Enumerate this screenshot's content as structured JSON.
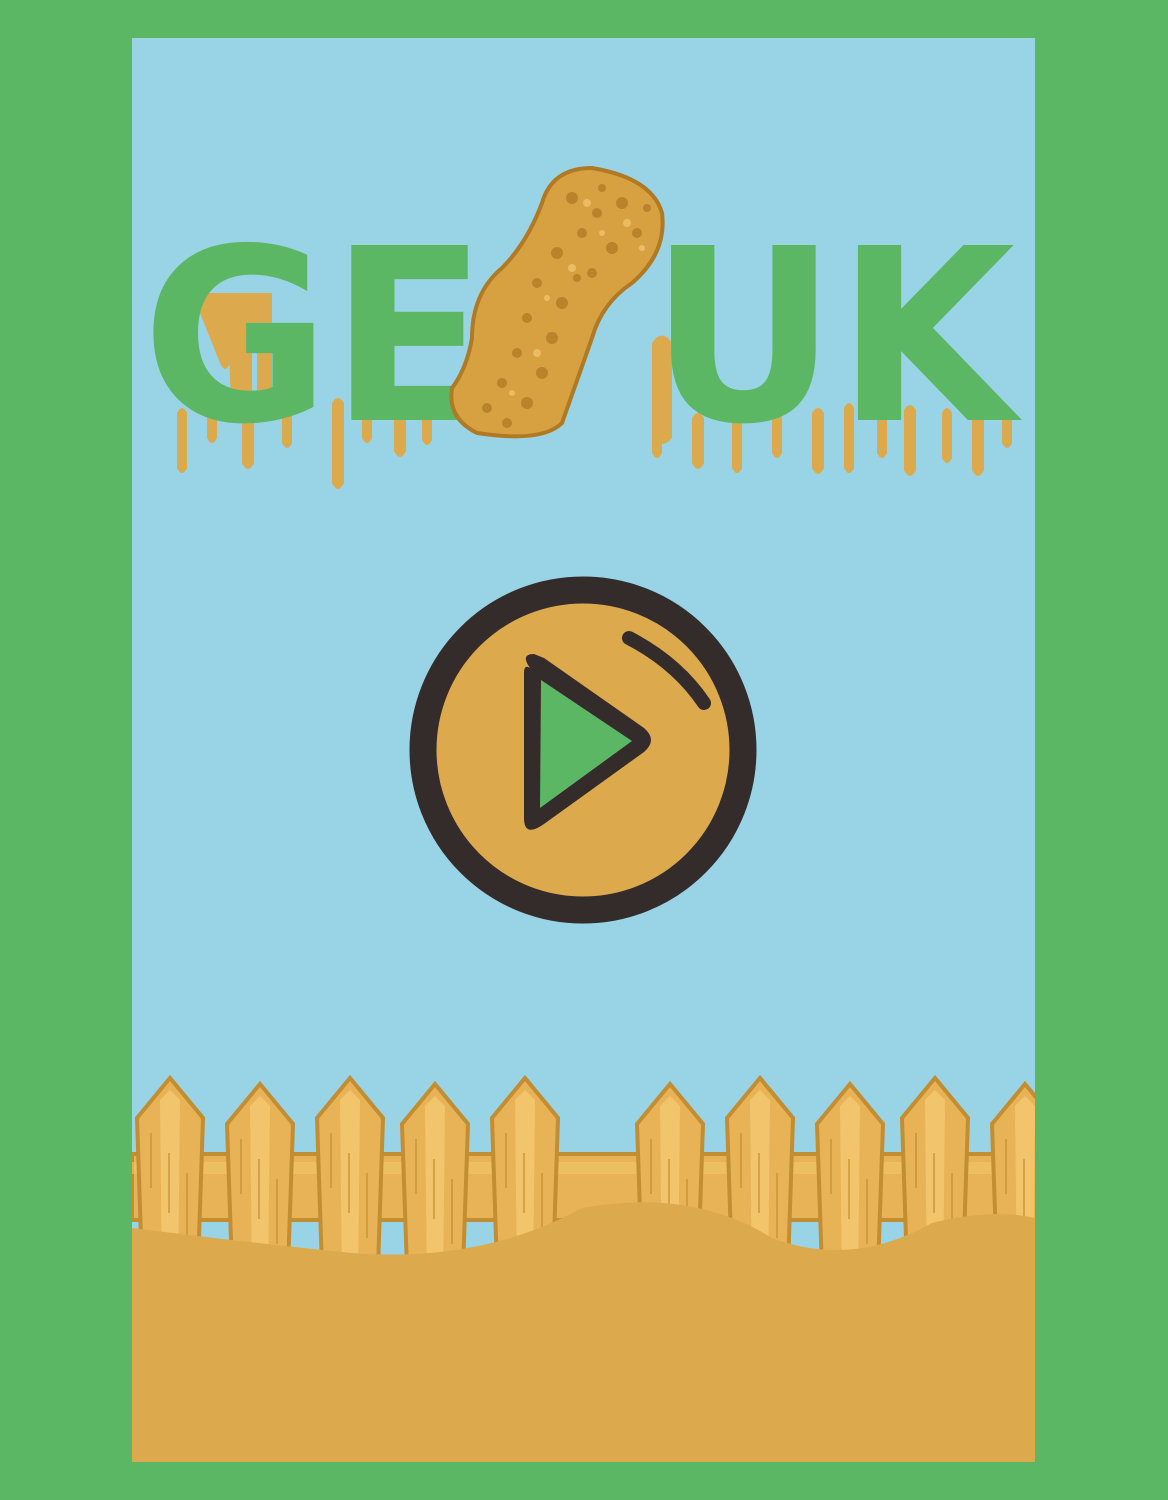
{
  "game": {
    "title_left": "GE",
    "title_right": "UK",
    "play_icon": "play-icon",
    "chicken_icon": "fried-chicken-leg-icon"
  },
  "colors": {
    "border": "#5cb764",
    "sky": "#98d4e5",
    "logo_green": "#5cb764",
    "drip": "#dcaa4d",
    "play_ring": "#342b2b",
    "play_fill": "#dcaa4d",
    "play_triangle": "#5cb764",
    "fence_light": "#f2c46c",
    "fence_mid": "#e8b356",
    "fence_outline": "#c38d31",
    "ground": "#dcaa4d"
  }
}
